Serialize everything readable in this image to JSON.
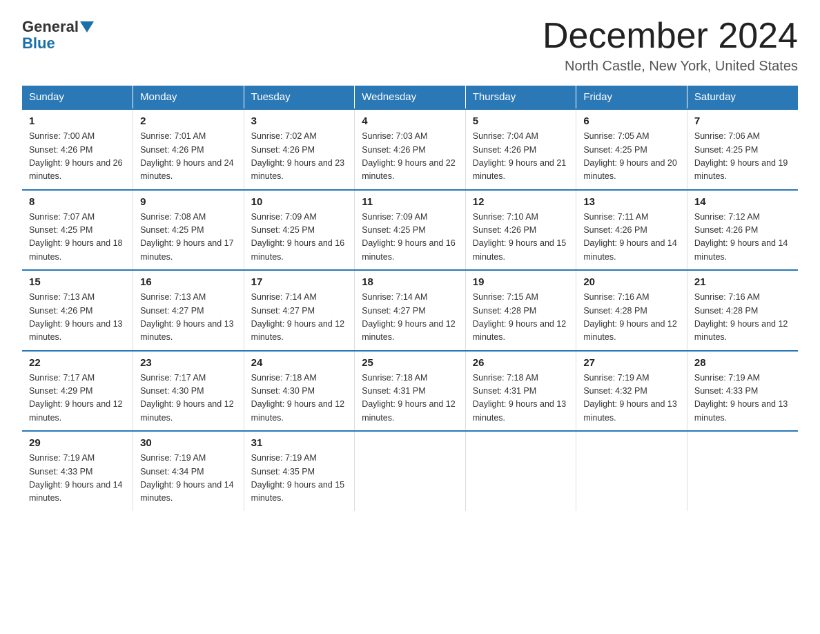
{
  "logo": {
    "general": "General",
    "blue": "Blue"
  },
  "title": "December 2024",
  "location": "North Castle, New York, United States",
  "days_of_week": [
    "Sunday",
    "Monday",
    "Tuesday",
    "Wednesday",
    "Thursday",
    "Friday",
    "Saturday"
  ],
  "weeks": [
    [
      {
        "day": "1",
        "sunrise": "7:00 AM",
        "sunset": "4:26 PM",
        "daylight": "9 hours and 26 minutes."
      },
      {
        "day": "2",
        "sunrise": "7:01 AM",
        "sunset": "4:26 PM",
        "daylight": "9 hours and 24 minutes."
      },
      {
        "day": "3",
        "sunrise": "7:02 AM",
        "sunset": "4:26 PM",
        "daylight": "9 hours and 23 minutes."
      },
      {
        "day": "4",
        "sunrise": "7:03 AM",
        "sunset": "4:26 PM",
        "daylight": "9 hours and 22 minutes."
      },
      {
        "day": "5",
        "sunrise": "7:04 AM",
        "sunset": "4:26 PM",
        "daylight": "9 hours and 21 minutes."
      },
      {
        "day": "6",
        "sunrise": "7:05 AM",
        "sunset": "4:25 PM",
        "daylight": "9 hours and 20 minutes."
      },
      {
        "day": "7",
        "sunrise": "7:06 AM",
        "sunset": "4:25 PM",
        "daylight": "9 hours and 19 minutes."
      }
    ],
    [
      {
        "day": "8",
        "sunrise": "7:07 AM",
        "sunset": "4:25 PM",
        "daylight": "9 hours and 18 minutes."
      },
      {
        "day": "9",
        "sunrise": "7:08 AM",
        "sunset": "4:25 PM",
        "daylight": "9 hours and 17 minutes."
      },
      {
        "day": "10",
        "sunrise": "7:09 AM",
        "sunset": "4:25 PM",
        "daylight": "9 hours and 16 minutes."
      },
      {
        "day": "11",
        "sunrise": "7:09 AM",
        "sunset": "4:25 PM",
        "daylight": "9 hours and 16 minutes."
      },
      {
        "day": "12",
        "sunrise": "7:10 AM",
        "sunset": "4:26 PM",
        "daylight": "9 hours and 15 minutes."
      },
      {
        "day": "13",
        "sunrise": "7:11 AM",
        "sunset": "4:26 PM",
        "daylight": "9 hours and 14 minutes."
      },
      {
        "day": "14",
        "sunrise": "7:12 AM",
        "sunset": "4:26 PM",
        "daylight": "9 hours and 14 minutes."
      }
    ],
    [
      {
        "day": "15",
        "sunrise": "7:13 AM",
        "sunset": "4:26 PM",
        "daylight": "9 hours and 13 minutes."
      },
      {
        "day": "16",
        "sunrise": "7:13 AM",
        "sunset": "4:27 PM",
        "daylight": "9 hours and 13 minutes."
      },
      {
        "day": "17",
        "sunrise": "7:14 AM",
        "sunset": "4:27 PM",
        "daylight": "9 hours and 12 minutes."
      },
      {
        "day": "18",
        "sunrise": "7:14 AM",
        "sunset": "4:27 PM",
        "daylight": "9 hours and 12 minutes."
      },
      {
        "day": "19",
        "sunrise": "7:15 AM",
        "sunset": "4:28 PM",
        "daylight": "9 hours and 12 minutes."
      },
      {
        "day": "20",
        "sunrise": "7:16 AM",
        "sunset": "4:28 PM",
        "daylight": "9 hours and 12 minutes."
      },
      {
        "day": "21",
        "sunrise": "7:16 AM",
        "sunset": "4:28 PM",
        "daylight": "9 hours and 12 minutes."
      }
    ],
    [
      {
        "day": "22",
        "sunrise": "7:17 AM",
        "sunset": "4:29 PM",
        "daylight": "9 hours and 12 minutes."
      },
      {
        "day": "23",
        "sunrise": "7:17 AM",
        "sunset": "4:30 PM",
        "daylight": "9 hours and 12 minutes."
      },
      {
        "day": "24",
        "sunrise": "7:18 AM",
        "sunset": "4:30 PM",
        "daylight": "9 hours and 12 minutes."
      },
      {
        "day": "25",
        "sunrise": "7:18 AM",
        "sunset": "4:31 PM",
        "daylight": "9 hours and 12 minutes."
      },
      {
        "day": "26",
        "sunrise": "7:18 AM",
        "sunset": "4:31 PM",
        "daylight": "9 hours and 13 minutes."
      },
      {
        "day": "27",
        "sunrise": "7:19 AM",
        "sunset": "4:32 PM",
        "daylight": "9 hours and 13 minutes."
      },
      {
        "day": "28",
        "sunrise": "7:19 AM",
        "sunset": "4:33 PM",
        "daylight": "9 hours and 13 minutes."
      }
    ],
    [
      {
        "day": "29",
        "sunrise": "7:19 AM",
        "sunset": "4:33 PM",
        "daylight": "9 hours and 14 minutes."
      },
      {
        "day": "30",
        "sunrise": "7:19 AM",
        "sunset": "4:34 PM",
        "daylight": "9 hours and 14 minutes."
      },
      {
        "day": "31",
        "sunrise": "7:19 AM",
        "sunset": "4:35 PM",
        "daylight": "9 hours and 15 minutes."
      },
      null,
      null,
      null,
      null
    ]
  ]
}
